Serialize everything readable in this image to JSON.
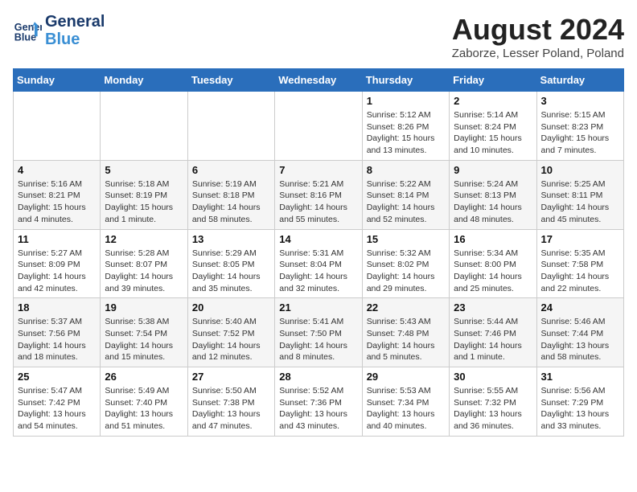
{
  "header": {
    "logo_line1": "General",
    "logo_line2": "Blue",
    "month_title": "August 2024",
    "location": "Zaborze, Lesser Poland, Poland"
  },
  "days_of_week": [
    "Sunday",
    "Monday",
    "Tuesday",
    "Wednesday",
    "Thursday",
    "Friday",
    "Saturday"
  ],
  "weeks": [
    [
      {
        "day": "",
        "info": ""
      },
      {
        "day": "",
        "info": ""
      },
      {
        "day": "",
        "info": ""
      },
      {
        "day": "",
        "info": ""
      },
      {
        "day": "1",
        "info": "Sunrise: 5:12 AM\nSunset: 8:26 PM\nDaylight: 15 hours\nand 13 minutes."
      },
      {
        "day": "2",
        "info": "Sunrise: 5:14 AM\nSunset: 8:24 PM\nDaylight: 15 hours\nand 10 minutes."
      },
      {
        "day": "3",
        "info": "Sunrise: 5:15 AM\nSunset: 8:23 PM\nDaylight: 15 hours\nand 7 minutes."
      }
    ],
    [
      {
        "day": "4",
        "info": "Sunrise: 5:16 AM\nSunset: 8:21 PM\nDaylight: 15 hours\nand 4 minutes."
      },
      {
        "day": "5",
        "info": "Sunrise: 5:18 AM\nSunset: 8:19 PM\nDaylight: 15 hours\nand 1 minute."
      },
      {
        "day": "6",
        "info": "Sunrise: 5:19 AM\nSunset: 8:18 PM\nDaylight: 14 hours\nand 58 minutes."
      },
      {
        "day": "7",
        "info": "Sunrise: 5:21 AM\nSunset: 8:16 PM\nDaylight: 14 hours\nand 55 minutes."
      },
      {
        "day": "8",
        "info": "Sunrise: 5:22 AM\nSunset: 8:14 PM\nDaylight: 14 hours\nand 52 minutes."
      },
      {
        "day": "9",
        "info": "Sunrise: 5:24 AM\nSunset: 8:13 PM\nDaylight: 14 hours\nand 48 minutes."
      },
      {
        "day": "10",
        "info": "Sunrise: 5:25 AM\nSunset: 8:11 PM\nDaylight: 14 hours\nand 45 minutes."
      }
    ],
    [
      {
        "day": "11",
        "info": "Sunrise: 5:27 AM\nSunset: 8:09 PM\nDaylight: 14 hours\nand 42 minutes."
      },
      {
        "day": "12",
        "info": "Sunrise: 5:28 AM\nSunset: 8:07 PM\nDaylight: 14 hours\nand 39 minutes."
      },
      {
        "day": "13",
        "info": "Sunrise: 5:29 AM\nSunset: 8:05 PM\nDaylight: 14 hours\nand 35 minutes."
      },
      {
        "day": "14",
        "info": "Sunrise: 5:31 AM\nSunset: 8:04 PM\nDaylight: 14 hours\nand 32 minutes."
      },
      {
        "day": "15",
        "info": "Sunrise: 5:32 AM\nSunset: 8:02 PM\nDaylight: 14 hours\nand 29 minutes."
      },
      {
        "day": "16",
        "info": "Sunrise: 5:34 AM\nSunset: 8:00 PM\nDaylight: 14 hours\nand 25 minutes."
      },
      {
        "day": "17",
        "info": "Sunrise: 5:35 AM\nSunset: 7:58 PM\nDaylight: 14 hours\nand 22 minutes."
      }
    ],
    [
      {
        "day": "18",
        "info": "Sunrise: 5:37 AM\nSunset: 7:56 PM\nDaylight: 14 hours\nand 18 minutes."
      },
      {
        "day": "19",
        "info": "Sunrise: 5:38 AM\nSunset: 7:54 PM\nDaylight: 14 hours\nand 15 minutes."
      },
      {
        "day": "20",
        "info": "Sunrise: 5:40 AM\nSunset: 7:52 PM\nDaylight: 14 hours\nand 12 minutes."
      },
      {
        "day": "21",
        "info": "Sunrise: 5:41 AM\nSunset: 7:50 PM\nDaylight: 14 hours\nand 8 minutes."
      },
      {
        "day": "22",
        "info": "Sunrise: 5:43 AM\nSunset: 7:48 PM\nDaylight: 14 hours\nand 5 minutes."
      },
      {
        "day": "23",
        "info": "Sunrise: 5:44 AM\nSunset: 7:46 PM\nDaylight: 14 hours\nand 1 minute."
      },
      {
        "day": "24",
        "info": "Sunrise: 5:46 AM\nSunset: 7:44 PM\nDaylight: 13 hours\nand 58 minutes."
      }
    ],
    [
      {
        "day": "25",
        "info": "Sunrise: 5:47 AM\nSunset: 7:42 PM\nDaylight: 13 hours\nand 54 minutes."
      },
      {
        "day": "26",
        "info": "Sunrise: 5:49 AM\nSunset: 7:40 PM\nDaylight: 13 hours\nand 51 minutes."
      },
      {
        "day": "27",
        "info": "Sunrise: 5:50 AM\nSunset: 7:38 PM\nDaylight: 13 hours\nand 47 minutes."
      },
      {
        "day": "28",
        "info": "Sunrise: 5:52 AM\nSunset: 7:36 PM\nDaylight: 13 hours\nand 43 minutes."
      },
      {
        "day": "29",
        "info": "Sunrise: 5:53 AM\nSunset: 7:34 PM\nDaylight: 13 hours\nand 40 minutes."
      },
      {
        "day": "30",
        "info": "Sunrise: 5:55 AM\nSunset: 7:32 PM\nDaylight: 13 hours\nand 36 minutes."
      },
      {
        "day": "31",
        "info": "Sunrise: 5:56 AM\nSunset: 7:29 PM\nDaylight: 13 hours\nand 33 minutes."
      }
    ]
  ],
  "colors": {
    "header_bg": "#2a6ebb",
    "accent": "#1a3a6b"
  }
}
